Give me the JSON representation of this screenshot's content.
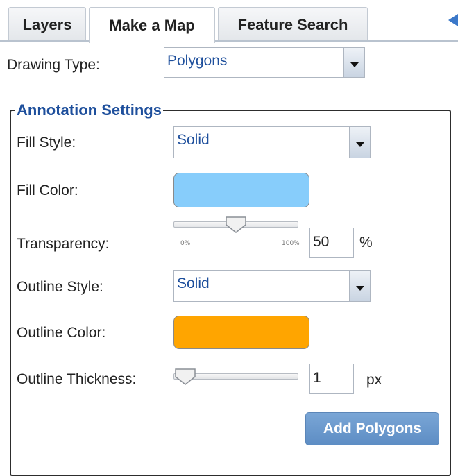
{
  "tabs": [
    {
      "label": "Layers",
      "active": false
    },
    {
      "label": "Make a Map",
      "active": true
    },
    {
      "label": "Feature Search",
      "active": false
    }
  ],
  "drawing_type": {
    "label": "Drawing Type:",
    "value": "Polygons"
  },
  "annotation": {
    "legend": "Annotation Settings",
    "fill_style": {
      "label": "Fill Style:",
      "value": "Solid"
    },
    "fill_color": {
      "label": "Fill Color:",
      "color": "#87cdfb"
    },
    "transparency": {
      "label": "Transparency:",
      "value": "50",
      "unit": "%",
      "min_label": "0%",
      "max_label": "100%",
      "level": 0.5
    },
    "outline_style": {
      "label": "Outline Style:",
      "value": "Solid"
    },
    "outline_color": {
      "label": "Outline Color:",
      "color": "#ffa500"
    },
    "outline_thickness": {
      "label": "Outline Thickness:",
      "value": "1",
      "unit": "px",
      "level": 0.0
    }
  },
  "add_button": {
    "label": "Add Polygons"
  },
  "colors": {
    "accent": "#1e4f9c",
    "button": "#6b98cc"
  },
  "icons": {
    "collapse": "collapse-left-icon",
    "dropdown": "chevron-down-icon",
    "slider_thumb": "slider-thumb-icon"
  }
}
